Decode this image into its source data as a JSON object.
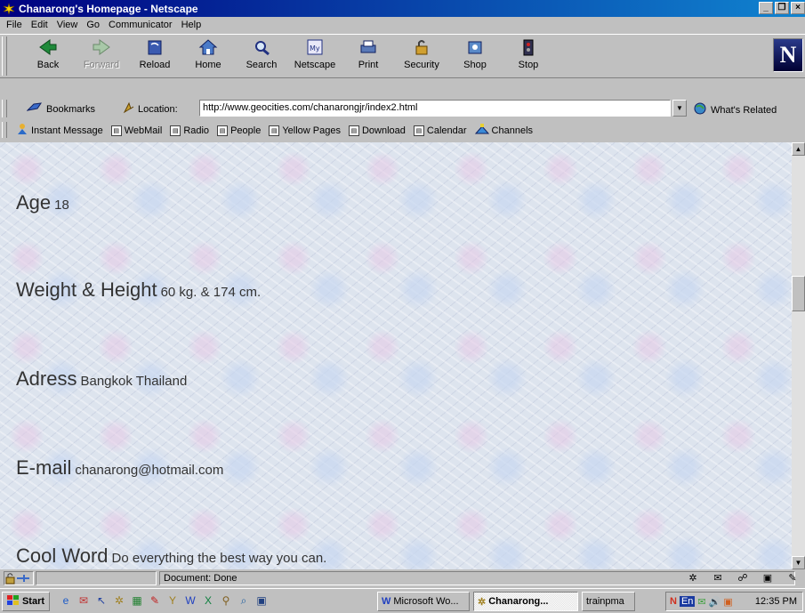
{
  "window": {
    "title": "Chanarong's Homepage - Netscape"
  },
  "menu": [
    "File",
    "Edit",
    "View",
    "Go",
    "Communicator",
    "Help"
  ],
  "nav_buttons": [
    {
      "label": "Back",
      "icon": "back-arrow-icon",
      "enabled": true
    },
    {
      "label": "Forward",
      "icon": "forward-arrow-icon",
      "enabled": false
    },
    {
      "label": "Reload",
      "icon": "reload-icon",
      "enabled": true
    },
    {
      "label": "Home",
      "icon": "home-icon",
      "enabled": true
    },
    {
      "label": "Search",
      "icon": "search-icon",
      "enabled": true
    },
    {
      "label": "Netscape",
      "icon": "netscape-icon",
      "enabled": true
    },
    {
      "label": "Print",
      "icon": "print-icon",
      "enabled": true
    },
    {
      "label": "Security",
      "icon": "lock-icon",
      "enabled": true
    },
    {
      "label": "Shop",
      "icon": "shop-icon",
      "enabled": true
    },
    {
      "label": "Stop",
      "icon": "stop-icon",
      "enabled": true
    }
  ],
  "location": {
    "bookmarks_label": "Bookmarks",
    "location_label": "Location:",
    "url": "http://www.geocities.com/chanarongjr/index2.html",
    "related_label": "What's Related"
  },
  "personal_bar": [
    "Instant Message",
    "WebMail",
    "Radio",
    "People",
    "Yellow Pages",
    "Download",
    "Calendar",
    "Channels"
  ],
  "page": {
    "fields": [
      {
        "label": "Age",
        "value": "18"
      },
      {
        "label": "Weight & Height",
        "value": "60 kg. & 174 cm."
      },
      {
        "label": "Adress",
        "value": "Bangkok Thailand"
      },
      {
        "label": "E-mail",
        "value": "chanarong@hotmail.com"
      },
      {
        "label": "Cool Word",
        "value": "Do everything the best way you can."
      }
    ]
  },
  "status": {
    "text": "Document: Done"
  },
  "taskbar": {
    "start_label": "Start",
    "tasks": [
      {
        "label": "Microsoft Wo...",
        "active": false
      },
      {
        "label": "Chanarong...",
        "active": true
      },
      {
        "label": "trainpma",
        "active": false
      }
    ],
    "tray_lang": "En",
    "clock": "12:35 PM"
  },
  "colors": {
    "titlebar": "#000080",
    "chrome": "#c0c0c0",
    "content_bg": "#dde4ee"
  }
}
